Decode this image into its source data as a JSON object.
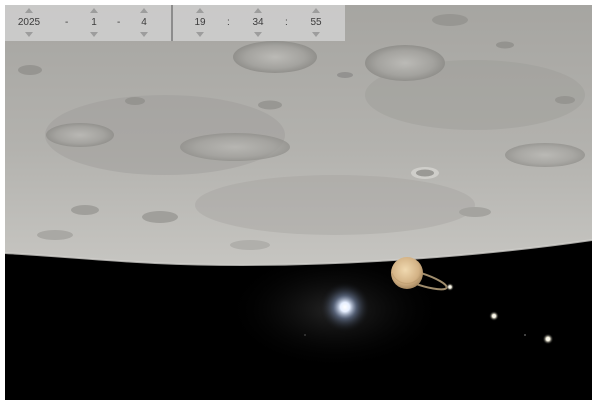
{
  "datetime": {
    "date": {
      "year": "2025",
      "month": "1",
      "day": "4",
      "separator": "-"
    },
    "time": {
      "hour": "19",
      "minute": "34",
      "second": "55",
      "separator": ":"
    }
  },
  "colors": {
    "lunar_surface": "#a9a8a4",
    "sky": "#000000",
    "saturn": "#d8bd92",
    "bright_star": "#cfe0ff",
    "control_bar": "#d4d4d4"
  },
  "scene": {
    "icons": [
      "moon-surface",
      "saturn-planet",
      "bright-star",
      "star-point"
    ]
  }
}
